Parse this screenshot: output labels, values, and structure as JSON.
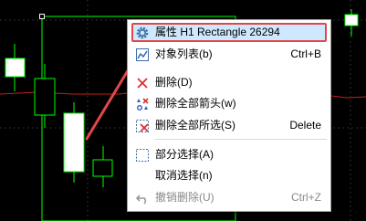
{
  "colors": {
    "chart_bg": "#000000",
    "grid": "#2e2e2e",
    "candle": "#00ff00",
    "indicator_line": "#c81e1e",
    "highlight_bg": "#cde8ff",
    "annotation": "#e04848"
  },
  "context_menu": {
    "items": [
      {
        "label": "属性 H1 Rectangle 26294",
        "shortcut": "",
        "icon": "gear-icon",
        "highlighted": true,
        "disabled": false
      },
      {
        "label": "对象列表(b)",
        "shortcut": "Ctrl+B",
        "icon": "object-list-icon",
        "highlighted": false,
        "disabled": false
      },
      {
        "label": "删除(D)",
        "shortcut": "",
        "icon": "delete-x-icon",
        "highlighted": false,
        "disabled": false
      },
      {
        "label": "删除全部箭头(w)",
        "shortcut": "",
        "icon": "delete-arrows-icon",
        "highlighted": false,
        "disabled": false
      },
      {
        "label": "删除全部所选(S)",
        "shortcut": "Delete",
        "icon": "delete-selected-icon",
        "highlighted": false,
        "disabled": false
      },
      {
        "label": "部分选择(A)",
        "shortcut": "",
        "icon": "partial-select-icon",
        "highlighted": false,
        "disabled": false
      },
      {
        "label": "取消选择(n)",
        "shortcut": "",
        "icon": "",
        "highlighted": false,
        "disabled": false
      },
      {
        "label": "撤销删除(U)",
        "shortcut": "Ctrl+Z",
        "icon": "undo-icon",
        "highlighted": false,
        "disabled": true
      }
    ]
  }
}
